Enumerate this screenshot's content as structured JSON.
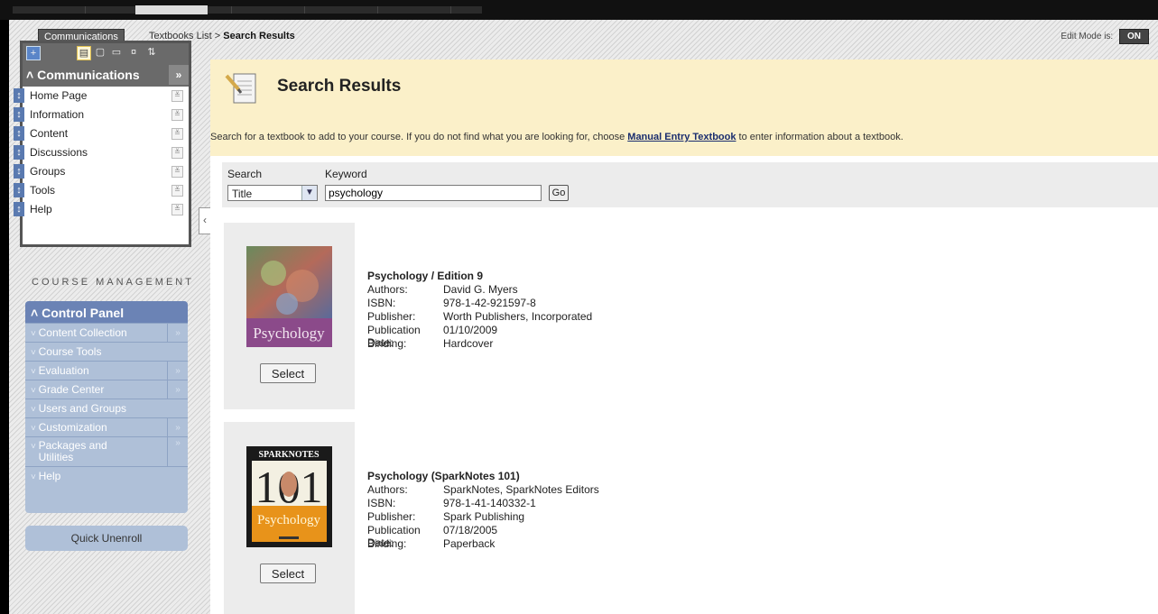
{
  "breadcrumb": {
    "course": "Communications",
    "parent": "Textbooks List",
    "separator": ">",
    "current": "Search Results"
  },
  "edit_mode": {
    "label": "Edit Mode is:",
    "state": "ON"
  },
  "course_menu": {
    "title": "Communications",
    "items": [
      {
        "label": "Home Page"
      },
      {
        "label": "Information"
      },
      {
        "label": "Content"
      },
      {
        "label": "Discussions"
      },
      {
        "label": "Groups"
      },
      {
        "label": "Tools"
      },
      {
        "label": "Help"
      }
    ]
  },
  "course_management": {
    "title": "COURSE MANAGEMENT",
    "panel_title": "Control Panel",
    "items": [
      {
        "label": "Content Collection",
        "has_arrow": true
      },
      {
        "label": "Course Tools",
        "has_arrow": false
      },
      {
        "label": "Evaluation",
        "has_arrow": true
      },
      {
        "label": "Grade Center",
        "has_arrow": true
      },
      {
        "label": "Users and Groups",
        "has_arrow": false
      },
      {
        "label": "Customization",
        "has_arrow": true
      },
      {
        "label": "Packages and Utilities",
        "has_arrow": true
      },
      {
        "label": "Help",
        "has_arrow": false
      }
    ],
    "quick_unenroll": "Quick Unenroll"
  },
  "page": {
    "title": "Search Results",
    "instructions_before": "Search for a textbook to add to your course. If you do not find what you are looking for, choose ",
    "instructions_link": "Manual Entry Textbook",
    "instructions_after": " to enter information about a textbook."
  },
  "search": {
    "search_label": "Search",
    "keyword_label": "Keyword",
    "search_by": "Title",
    "keyword_value": "psychology",
    "go_label": "Go"
  },
  "field_labels": {
    "authors": "Authors:",
    "isbn": "ISBN:",
    "publisher": "Publisher:",
    "pub_date": "Publication Date:",
    "binding": "Binding:"
  },
  "results": [
    {
      "title": "Psychology / Edition 9",
      "authors": "David G. Myers",
      "isbn": "978-1-42-921597-8",
      "publisher": "Worth Publishers, Incorporated",
      "pub_date": "01/10/2009",
      "binding": "Hardcover",
      "cover_text": "Psychology",
      "select_label": "Select"
    },
    {
      "title": "Psychology (SparkNotes 101)",
      "authors": "SparkNotes, SparkNotes Editors",
      "isbn": "978-1-41-140332-1",
      "publisher": "Spark Publishing",
      "pub_date": "07/18/2005",
      "binding": "Paperback",
      "cover_brand": "SPARKNOTES",
      "cover_number": "101",
      "cover_text": "Psychology",
      "select_label": "Select"
    }
  ],
  "colors": {
    "header_bg": "#fbf0c9",
    "panel_blue": "#afc0d8",
    "panel_head": "#6b83b5",
    "link": "#1a2d6e"
  }
}
